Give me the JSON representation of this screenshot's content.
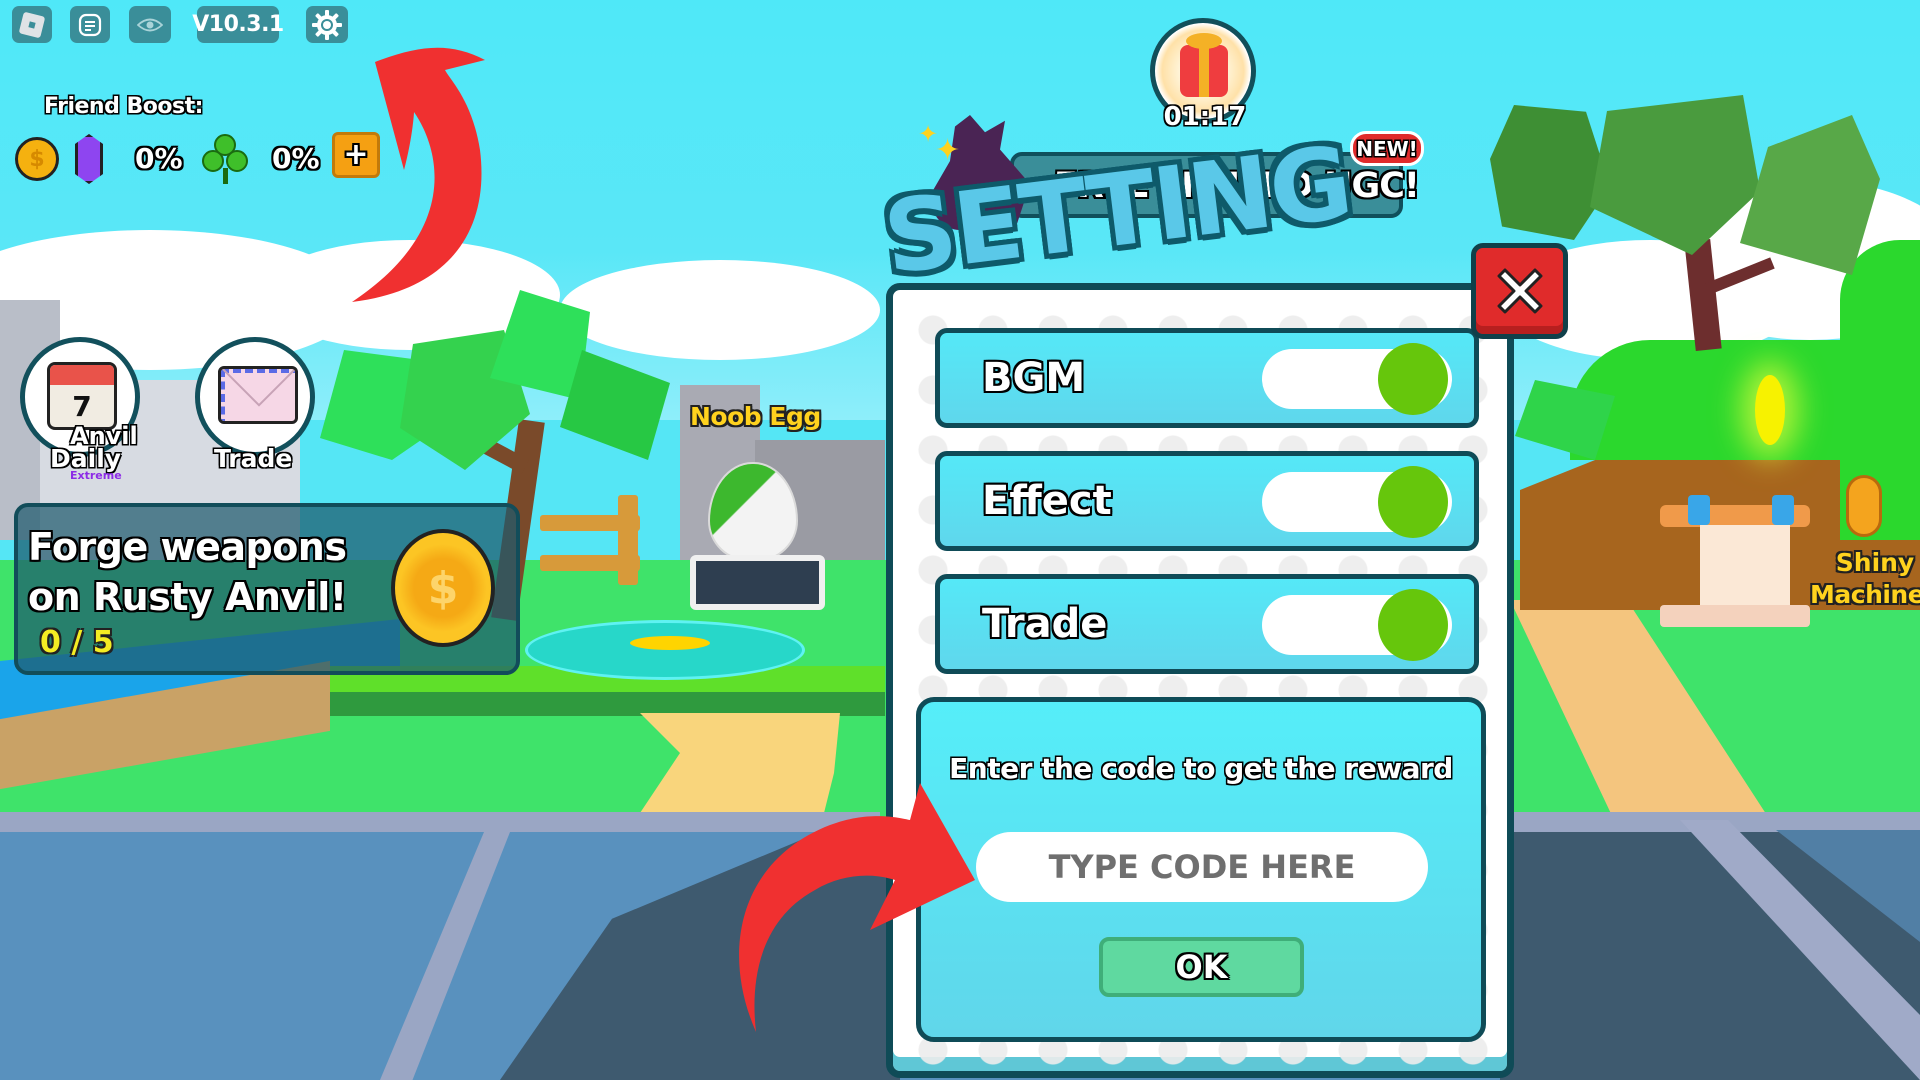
{
  "hud": {
    "roblox_menu_icon": "roblox-logo-icon",
    "chat_icon": "chat-icon",
    "visibility_icon": "eye-icon",
    "version": "V10.3.1",
    "settings_icon": "gear-icon"
  },
  "friend_boost": {
    "label": "Friend Boost:",
    "coin_icon": "coin-icon",
    "gem_icon": "gem-icon",
    "gem_percent": "0%",
    "luck_icon": "clover-icon",
    "luck_percent": "0%",
    "add_icon": "plus-icon"
  },
  "side_buttons": [
    {
      "label": "Daily",
      "sublabel": "Extreme",
      "icon": "calendar-icon",
      "calendar_day": "7",
      "overlap_text": "Anvil"
    },
    {
      "label": "Trade",
      "icon": "envelope-icon"
    }
  ],
  "quest": {
    "line1": "Forge weapons",
    "line2": "on Rusty Anvil!",
    "progress_text": "0 / 5",
    "progress_current": 0,
    "progress_total": 5,
    "reward_icon": "coin-icon"
  },
  "world_labels": {
    "egg": "Noob Egg",
    "machine_line1": "Shiny",
    "machine_line2": "Machine"
  },
  "gift_timer": {
    "icon": "gift-icon",
    "time": "01:17"
  },
  "ugc_banner": {
    "text": "FREE LIMITED UGC!",
    "badge": "NEW!"
  },
  "settings": {
    "title": "SETTING",
    "close_icon": "close-icon",
    "toggles": [
      {
        "label": "BGM",
        "on": true
      },
      {
        "label": "Effect",
        "on": true
      },
      {
        "label": "Trade",
        "on": true
      }
    ],
    "code": {
      "hint": "Enter the code to get the reward",
      "placeholder": "TYPE CODE HERE",
      "value": "",
      "submit_label": "OK"
    }
  },
  "colors": {
    "panel_border": "#0f4b57",
    "row_fill": "#55e8f7",
    "toggle_on": "#66c60c",
    "close_red": "#e02b2b",
    "ok_green": "#5fd9a0",
    "annotation_arrow": "#f03030"
  }
}
